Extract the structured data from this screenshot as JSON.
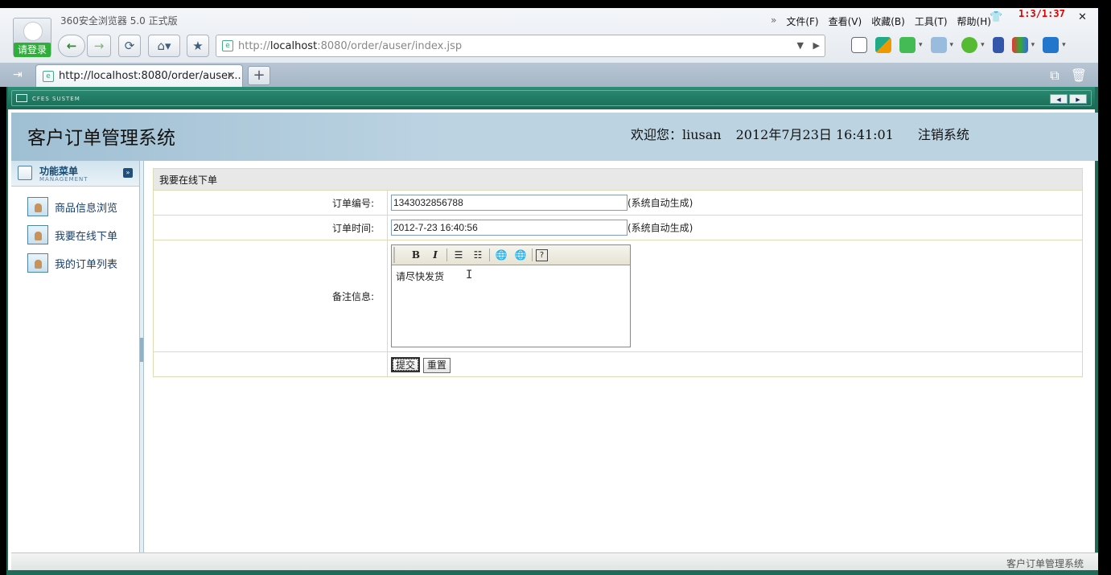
{
  "browser": {
    "title": "360安全浏览器 5.0 正式版",
    "login_label": "请登录",
    "menus": [
      "文件(F)",
      "查看(V)",
      "收藏(B)",
      "工具(T)",
      "帮助(H)"
    ],
    "clock_overlay": "1:3/1:37",
    "address_prefix": "http://",
    "address_host": "localhost",
    "address_rest": ":8080/order/auser/index.jsp",
    "tab_title": "http://localhost:8080/order/auser...",
    "tab_close": "×",
    "new_tab": "+"
  },
  "app": {
    "bar_label": "CFES SUSTEM",
    "system_title": "客户订单管理系统",
    "welcome_label": "欢迎您：liusan",
    "datetime": "2012年7月23日  16:41:01",
    "logout_label": "注销系统"
  },
  "sidebar": {
    "title": "功能菜单",
    "subtitle": "MANAGEMENT",
    "items": [
      {
        "label": "商品信息浏览"
      },
      {
        "label": "我要在线下单"
      },
      {
        "label": "我的订单列表"
      }
    ]
  },
  "form": {
    "caption": "我要在线下单",
    "order_no_label": "订单编号:",
    "order_no_value": "1343032856788",
    "order_no_hint": "(系统自动生成)",
    "order_time_label": "订单时间:",
    "order_time_value": "2012-7-23 16:40:56",
    "order_time_hint": "(系统自动生成)",
    "remark_label": "备注信息:",
    "remark_value": "请尽快发货",
    "submit_label": "提交",
    "reset_label": "重置"
  },
  "status": {
    "text": "客户订单管理系统"
  }
}
